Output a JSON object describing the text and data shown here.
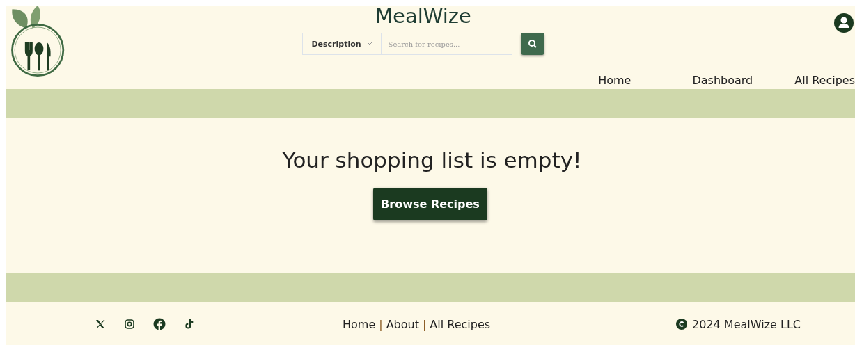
{
  "header": {
    "title": "MealWize",
    "search": {
      "filter": "Description",
      "placeholder": "Search for recipes..."
    },
    "nav": [
      {
        "label": "Home"
      },
      {
        "label": "Dashboard"
      },
      {
        "label": "All Recipes"
      }
    ]
  },
  "main": {
    "message": "Your shopping list is empty!",
    "button": "Browse Recipes"
  },
  "footer": {
    "social": [
      {
        "kind": "x"
      },
      {
        "kind": "instagram"
      },
      {
        "kind": "facebook"
      },
      {
        "kind": "tiktok"
      }
    ],
    "links": [
      {
        "kind": "link",
        "text": "Home"
      },
      {
        "kind": "separator",
        "text": "|"
      },
      {
        "kind": "link",
        "text": "About"
      },
      {
        "kind": "separator",
        "text": "|"
      },
      {
        "kind": "link",
        "text": "All Recipes"
      }
    ],
    "copyright": "2024 MealWize LLC"
  }
}
